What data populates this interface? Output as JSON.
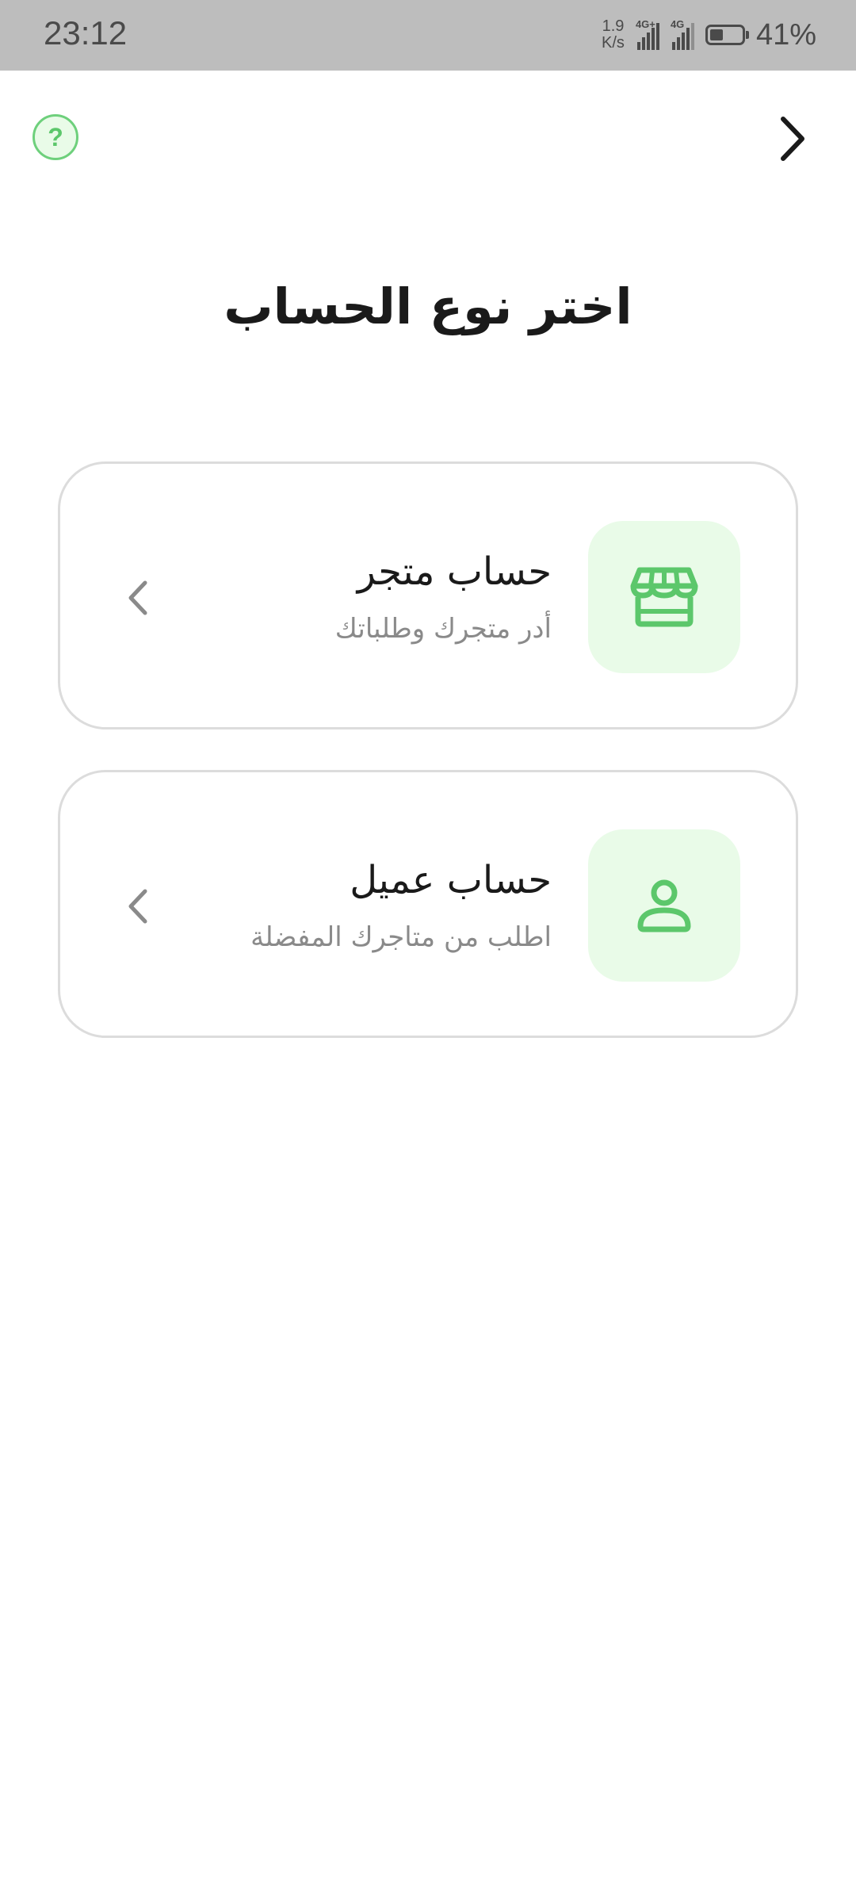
{
  "status_bar": {
    "time": "23:12",
    "net_speed_value": "1.9",
    "net_speed_unit": "K/s",
    "sim1_tag": "4G+",
    "sim2_tag": "4G",
    "battery": "41%"
  },
  "header": {
    "help_label": "?",
    "forward_icon": "chevron-right-icon",
    "help_icon": "question-icon"
  },
  "page": {
    "title": "اختر نوع الحساب"
  },
  "options": [
    {
      "title": "حساب متجر",
      "subtitle": "أدر متجرك وطلباتك",
      "icon": "store-icon"
    },
    {
      "title": "حساب عميل",
      "subtitle": "اطلب من متاجرك المفضلة",
      "icon": "user-icon"
    }
  ],
  "colors": {
    "accent": "#5cc76b",
    "accent_bg": "#e9fbe8",
    "card_border": "#dcdcdc",
    "title_text": "#1a1a1a",
    "subtitle_text": "#8a8a8a",
    "status_bar_bg": "#bdbdbd"
  }
}
